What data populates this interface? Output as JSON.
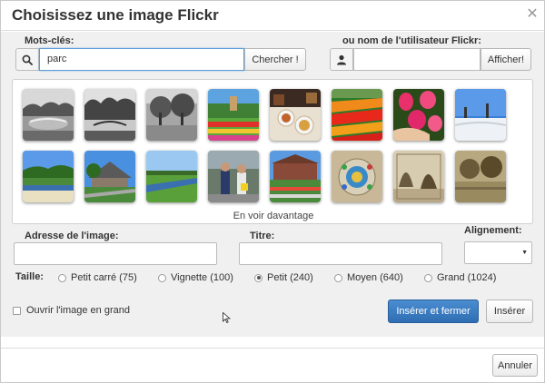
{
  "dialog": {
    "title": "Choisissez une image Flickr",
    "close_icon": "close-icon"
  },
  "search": {
    "keywords_label": "Mots-clés:",
    "keywords_value": "parc",
    "search_icon": "search-icon",
    "search_button": "Chercher !",
    "user_label": "ou nom de l'utilisateur Flickr:",
    "user_icon": "user-icon",
    "user_value": "",
    "user_button": "Afficher!"
  },
  "gallery": {
    "thumbnails": [
      "park-with-pond-bw",
      "park-bridge-bw",
      "park-trees-bw",
      "flower-garden-tower",
      "food-table",
      "tulip-field",
      "pink-tulips",
      "snowy-park",
      "canal-park",
      "pavilion-river",
      "canal-meadow",
      "people-walking",
      "park-restaurant",
      "mosaic-sculpture",
      "old-engraving",
      "sepia-park"
    ],
    "more_link": "En voir davantage"
  },
  "form": {
    "address_label": "Adresse de l'image:",
    "address_value": "",
    "title_label": "Titre:",
    "title_value": "",
    "align_label": "Alignement:",
    "align_value": "",
    "size_label": "Taille:",
    "size_options": [
      {
        "label": "Petit carré (75)",
        "checked": false
      },
      {
        "label": "Vignette (100)",
        "checked": false
      },
      {
        "label": "Petit (240)",
        "checked": true
      },
      {
        "label": "Moyen (640)",
        "checked": false
      },
      {
        "label": "Grand (1024)",
        "checked": false
      }
    ],
    "open_large_label": "Ouvrir l'image en grand",
    "open_large_checked": false
  },
  "actions": {
    "insert_close": "Insérer et fermer",
    "insert": "Insérer",
    "cancel": "Annuler"
  },
  "colors": {
    "primary": "#3a7ec2",
    "focus": "#5b9dd9"
  }
}
